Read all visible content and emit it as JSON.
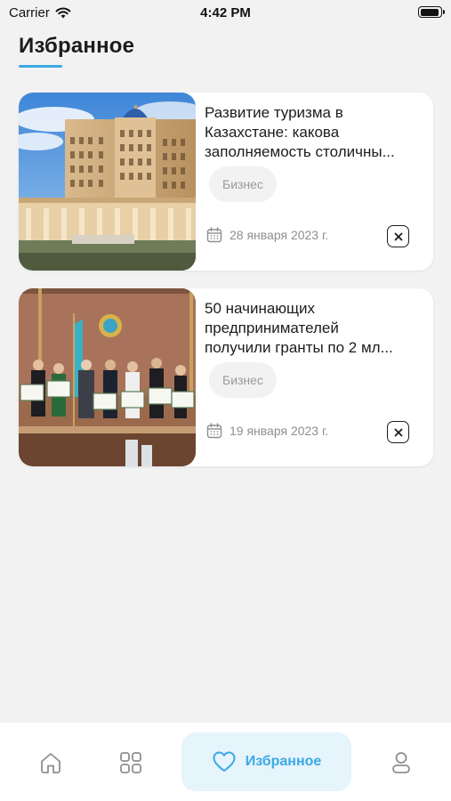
{
  "status": {
    "carrier": "Carrier",
    "time": "4:42 PM",
    "battery_level": 0.95
  },
  "header": {
    "title": "Избранное"
  },
  "favorites": [
    {
      "title_lines": [
        "Развитие туризма в",
        "Казахстане: какова",
        "заполняемость столичны..."
      ],
      "category": "Бизнес",
      "date": "28 января 2023 г.",
      "image_icon": "hotel-building-photo"
    },
    {
      "title_lines": [
        "50 начинающих",
        "предпринимателей",
        "получили гранты по 2 мл..."
      ],
      "category": "Бизнес",
      "date": "19 января 2023 г.",
      "image_icon": "grant-ceremony-photo"
    }
  ],
  "tabbar": {
    "active_tab": "favorites",
    "favorites_label": "Избранное",
    "accent_color": "#3aa9e6",
    "icons": [
      "home-icon",
      "grid-icon",
      "heart-icon",
      "profile-icon"
    ]
  }
}
